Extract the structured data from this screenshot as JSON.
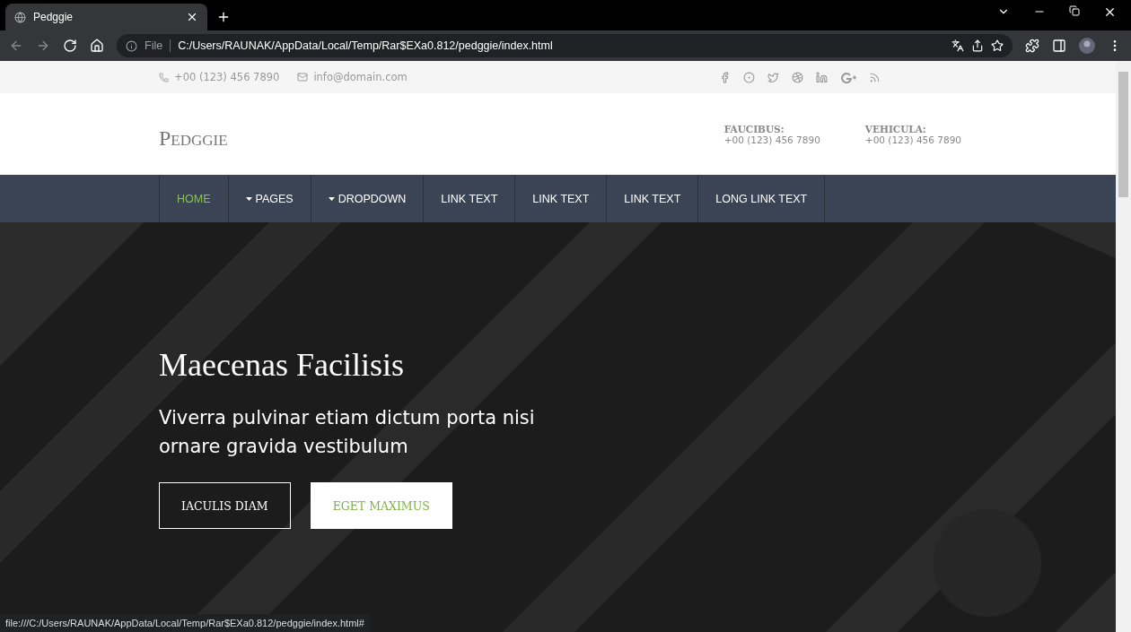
{
  "browser": {
    "tab": {
      "title": "Pedggie",
      "selected": true
    },
    "address": {
      "scheme": "File",
      "url": "C:/Users/RAUNAK/AppData/Local/Temp/Rar$EXa0.812/pedggie/index.html"
    },
    "status_url": "file:///C:/Users/RAUNAK/AppData/Local/Temp/Rar$EXa0.812/pedggie/index.html#"
  },
  "topbar": {
    "phone": "+00 (123) 456 7890",
    "email": "info@domain.com"
  },
  "header": {
    "logo": "Pedggie",
    "contacts": [
      {
        "label": "FAUCIBUS:",
        "value": "+00 (123) 456 7890"
      },
      {
        "label": "VEHICULA:",
        "value": "+00 (123) 456 7890"
      }
    ]
  },
  "nav": [
    {
      "label": "HOME",
      "kind": "link",
      "selected": true
    },
    {
      "label": "PAGES",
      "kind": "dropdown",
      "selected": false
    },
    {
      "label": "DROPDOWN",
      "kind": "dropdown",
      "selected": false
    },
    {
      "label": "LINK TEXT",
      "kind": "link",
      "selected": false
    },
    {
      "label": "LINK TEXT",
      "kind": "link",
      "selected": false
    },
    {
      "label": "LINK TEXT",
      "kind": "link",
      "selected": false
    },
    {
      "label": "LONG LINK TEXT",
      "kind": "link",
      "selected": false
    }
  ],
  "hero": {
    "kind": "picture",
    "title": "Maecenas Facilisis",
    "subtitle": "Viverra pulvinar etiam dictum porta nisi ornare gravida vestibulum",
    "buttons": [
      {
        "label": "IACULIS DIAM",
        "kind": "outline"
      },
      {
        "label": "EGET MAXIMUS",
        "kind": "solid"
      }
    ]
  }
}
